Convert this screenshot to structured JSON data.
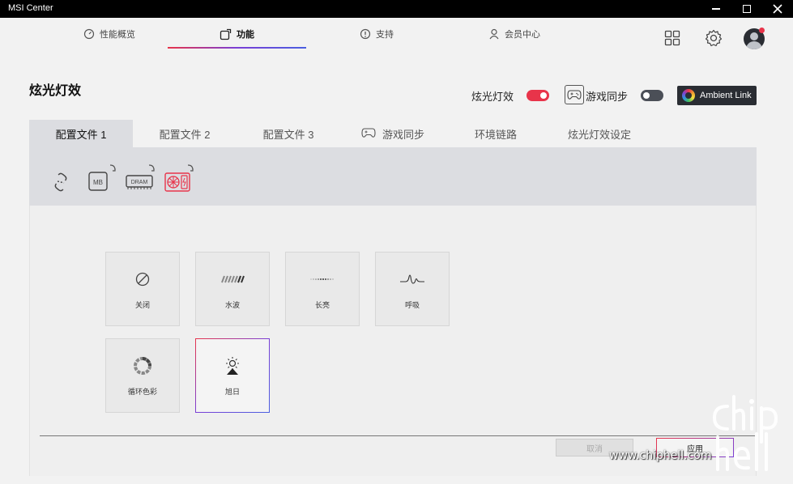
{
  "window": {
    "title": "MSI Center"
  },
  "nav": {
    "tabs": [
      {
        "label": "性能概览",
        "icon": "gauge-icon"
      },
      {
        "label": "功能",
        "icon": "features-icon",
        "active": true
      },
      {
        "label": "支持",
        "icon": "support-icon"
      },
      {
        "label": "会员中心",
        "icon": "user-icon"
      }
    ]
  },
  "page": {
    "title": "炫光灯效",
    "rgb_toggle_label": "炫光灯效",
    "game_sync_label": "游戏同步",
    "rgb_toggle_on": true,
    "game_sync_on": false,
    "ambient_link_label": "Ambient Link"
  },
  "profile_tabs": [
    {
      "label": "配置文件 1",
      "active": true
    },
    {
      "label": "配置文件 2"
    },
    {
      "label": "配置文件 3"
    },
    {
      "label": "游戏同步",
      "icon": "gamepad-icon"
    },
    {
      "label": "环境链路"
    },
    {
      "label": "炫光灯效设定"
    }
  ],
  "devices": [
    {
      "name": "link-sync-icon"
    },
    {
      "name": "motherboard-icon",
      "text": "MB"
    },
    {
      "name": "dram-icon",
      "text": "DRAM"
    },
    {
      "name": "fan-device-icon",
      "selected": true
    }
  ],
  "effects": [
    {
      "label": "关闭",
      "icon": "off-icon"
    },
    {
      "label": "水波",
      "icon": "wave-icon"
    },
    {
      "label": "长亮",
      "icon": "steady-icon"
    },
    {
      "label": "呼吸",
      "icon": "breathing-icon"
    },
    {
      "label": "循环色彩",
      "icon": "color-cycle-icon"
    },
    {
      "label": "旭日",
      "icon": "sunrise-icon",
      "selected": true
    }
  ],
  "actions": {
    "cancel_label": "取消",
    "apply_label": "应用"
  },
  "watermark": {
    "text": "www.chiphell.com"
  },
  "colors": {
    "accent_red": "#e8344a",
    "accent_purple": "#7a3fd6",
    "dark": "#2a2d33"
  }
}
